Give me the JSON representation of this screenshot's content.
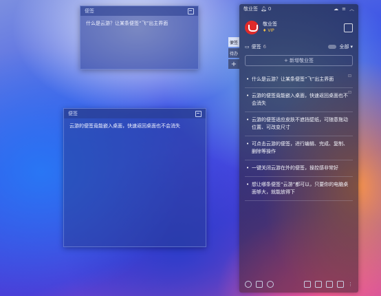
{
  "note_top": {
    "title": "便签",
    "body": "什么是云游？让某条便签“飞”出主界面"
  },
  "note_mid": {
    "title": "便签",
    "body": "云游的便签竟能嵌入桌面，快速返回桌面也不会消失"
  },
  "panel": {
    "app_name": "敬业签",
    "badge_count": "0",
    "user_name": "敬业签",
    "vip_label": "VIP",
    "section_title": "便签",
    "section_count": "6",
    "filter_label": "全部",
    "new_button": "+ 新增敬业签",
    "items": [
      "什么是云游？让某条便签“飞”出主界面",
      "云游的便签竟能嵌入桌面，快速返回桌面也不会消失",
      "云游的便签适应皮肤不遮挡壁纸，可随意拖动位置、可改变尺寸",
      "可点击云游的便签，进行编辑、完成、复制、删除等操作",
      "一键关闭云游在外的便签，操控感非常好",
      "想让哪条便签“云游”都可以，只要你的电脑桌面够大，就能放得下"
    ]
  },
  "side_tabs": [
    "便签",
    "待办",
    "+"
  ],
  "icons": [
    "bell-icon",
    "cloud-icon",
    "menu-icon",
    "collapse-icon",
    "calendar-icon",
    "embed-icon",
    "pin-icon",
    "clock-icon",
    "calendar-small-icon",
    "search-icon",
    "add-icon",
    "grid-icon",
    "list-icon",
    "more-icon"
  ]
}
